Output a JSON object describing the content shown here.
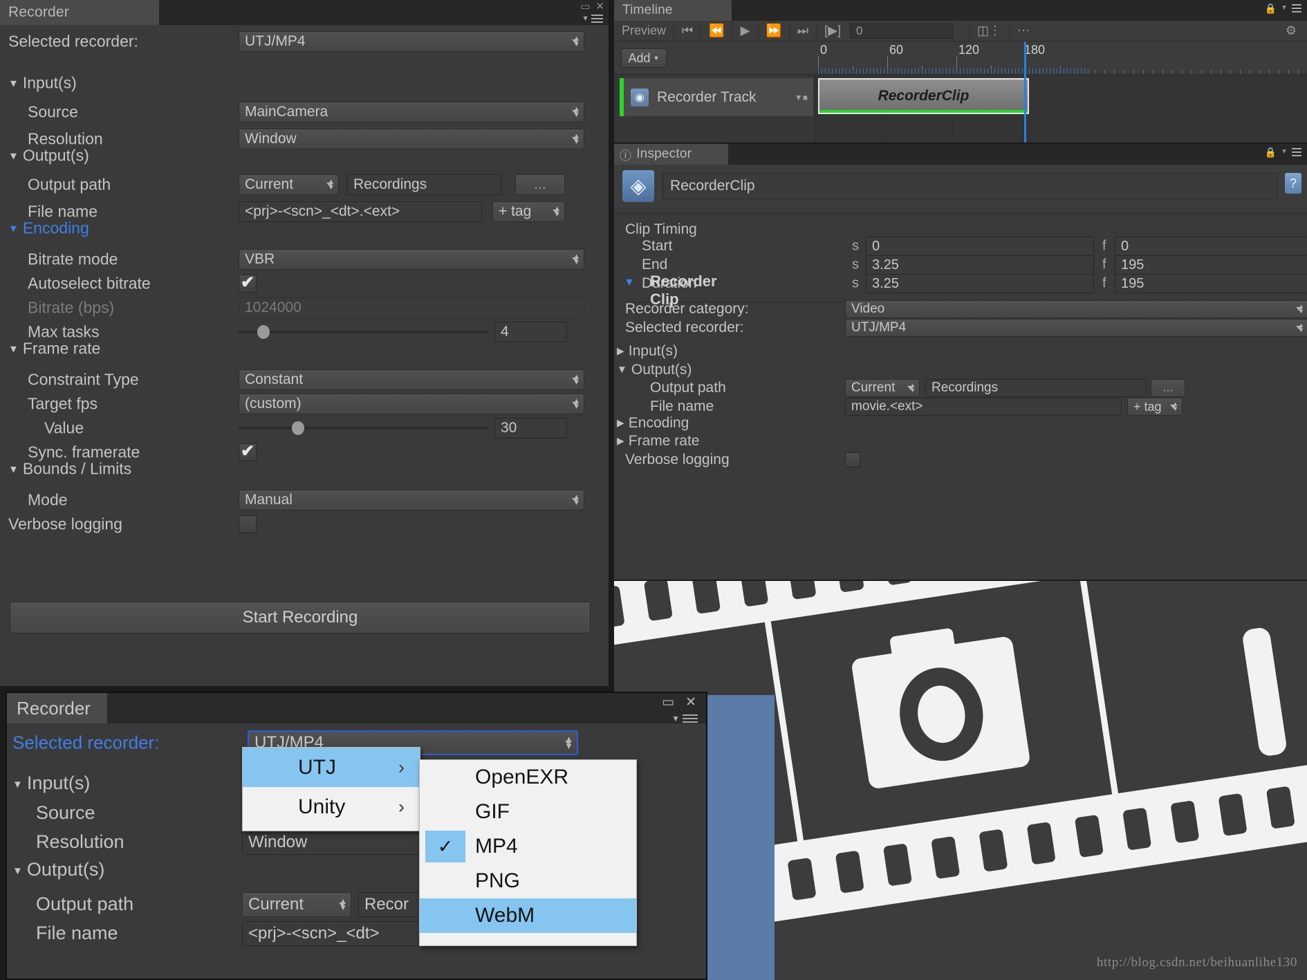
{
  "recorder_window": {
    "tab_label": "Recorder",
    "selected_recorder_label": "Selected recorder:",
    "selected_recorder_value": "UTJ/MP4",
    "sections": {
      "inputs": {
        "title": "Input(s)",
        "source_label": "Source",
        "source_value": "MainCamera",
        "resolution_label": "Resolution",
        "resolution_value": "Window"
      },
      "outputs": {
        "title": "Output(s)",
        "output_path_label": "Output path",
        "output_path_mode": "Current",
        "output_path_value": "Recordings",
        "browse_label": "...",
        "file_name_label": "File name",
        "file_name_value": "<prj>-<scn>_<dt>.<ext>",
        "tag_label": "+ tag"
      },
      "encoding": {
        "title": "Encoding",
        "bitrate_mode_label": "Bitrate mode",
        "bitrate_mode_value": "VBR",
        "autoselect_label": "Autoselect bitrate",
        "autoselect_checked": true,
        "bitrate_label": "Bitrate (bps)",
        "bitrate_value": "1024000",
        "bitrate_disabled": true,
        "max_tasks_label": "Max tasks",
        "max_tasks_value": "4",
        "max_tasks_slider_pct": 9
      },
      "frame_rate": {
        "title": "Frame rate",
        "constraint_label": "Constraint Type",
        "constraint_value": "Constant",
        "target_fps_label": "Target fps",
        "target_fps_value": "(custom)",
        "value_label": "Value",
        "value_value": "30",
        "value_slider_pct": 25,
        "sync_label": "Sync. framerate",
        "sync_checked": true
      },
      "bounds": {
        "title": "Bounds / Limits",
        "mode_label": "Mode",
        "mode_value": "Manual"
      },
      "verbose_label": "Verbose logging",
      "verbose_checked": false
    },
    "start_button": "Start Recording"
  },
  "timeline": {
    "tab_label": "Timeline",
    "preview_label": "Preview",
    "transport": [
      {
        "name": "first-frame-icon",
        "glyph": "⏮"
      },
      {
        "name": "previous-frame-icon",
        "glyph": "◀▏"
      },
      {
        "name": "play-icon",
        "glyph": "▶"
      },
      {
        "name": "next-frame-icon",
        "glyph": "▏▶"
      },
      {
        "name": "last-frame-icon",
        "glyph": "⏭"
      }
    ],
    "play_range_icon": "[▶]",
    "frame_value": "0",
    "lock_icon": "🔒",
    "options_icon": "⋯",
    "settings_icon": "⚙",
    "add_button": "Add",
    "ruler_labels": [
      "0",
      "60",
      "120",
      "180"
    ],
    "track_name": "Recorder Track",
    "clip_name": "RecorderClip"
  },
  "inspector": {
    "tab_label": "Inspector",
    "info_icon": "ⓘ",
    "asset_icon": "◈",
    "object_name": "RecorderClip",
    "help_icon": "?",
    "clip_timing": {
      "title": "Clip Timing",
      "unit_seconds": "s",
      "unit_frames": "f",
      "rows": [
        {
          "label": "Start",
          "seconds": "0",
          "frames": "0"
        },
        {
          "label": "End",
          "seconds": "3.25",
          "frames": "195"
        },
        {
          "label": "Duration",
          "seconds": "3.25",
          "frames": "195"
        }
      ]
    },
    "recorder_clip": {
      "title": "Recorder Clip",
      "category_label": "Recorder category:",
      "category_value": "Video",
      "selected_recorder_label": "Selected recorder:",
      "selected_recorder_value": "UTJ/MP4",
      "inputs_title": "Input(s)",
      "outputs_title": "Output(s)",
      "output_path_label": "Output path",
      "output_path_mode": "Current",
      "output_path_value": "Recordings",
      "browse_label": "...",
      "file_name_label": "File name",
      "file_name_value": "movie.<ext>",
      "tag_label": "+ tag",
      "encoding_title": "Encoding",
      "frame_rate_title": "Frame rate",
      "verbose_label": "Verbose logging",
      "verbose_checked": false
    }
  },
  "recorder_window_2": {
    "tab_label": "Recorder",
    "maximize_icon": "▭",
    "close_icon": "✕",
    "selected_recorder_label": "Selected recorder:",
    "selected_recorder_value": "UTJ/MP4",
    "inputs_title": "Input(s)",
    "source_label": "Source",
    "resolution_label": "Resolution",
    "resolution_value": "Window",
    "outputs_title": "Output(s)",
    "output_path_label": "Output path",
    "output_path_mode": "Current",
    "output_path_value": "Recor",
    "file_name_label": "File name",
    "file_name_value": "<prj>-<scn>_<dt>"
  },
  "menu_level1": {
    "items": [
      {
        "label": "UTJ",
        "selected": true,
        "has_submenu": true,
        "submenu_arrow": "›"
      },
      {
        "label": "Unity",
        "selected": false,
        "has_submenu": true,
        "submenu_arrow": "›"
      }
    ]
  },
  "menu_level2": {
    "items": [
      {
        "label": "OpenEXR",
        "checked": false,
        "highlighted": false
      },
      {
        "label": "GIF",
        "checked": false,
        "highlighted": false
      },
      {
        "label": "MP4",
        "checked": true,
        "highlighted": false,
        "check_glyph": "✓"
      },
      {
        "label": "PNG",
        "checked": false,
        "highlighted": false
      },
      {
        "label": "WebM",
        "checked": false,
        "highlighted": true
      }
    ]
  },
  "watermark": "http://blog.csdn.net/beihuanlihe130",
  "colors": {
    "panel_bg": "#3a3a3a",
    "tab_bg": "#4a4a4a",
    "accent_blue": "#3e7fe8",
    "menu_highlight": "#86c5f0",
    "track_green": "#2bd42b",
    "playhead_blue": "#2b7fe0"
  }
}
